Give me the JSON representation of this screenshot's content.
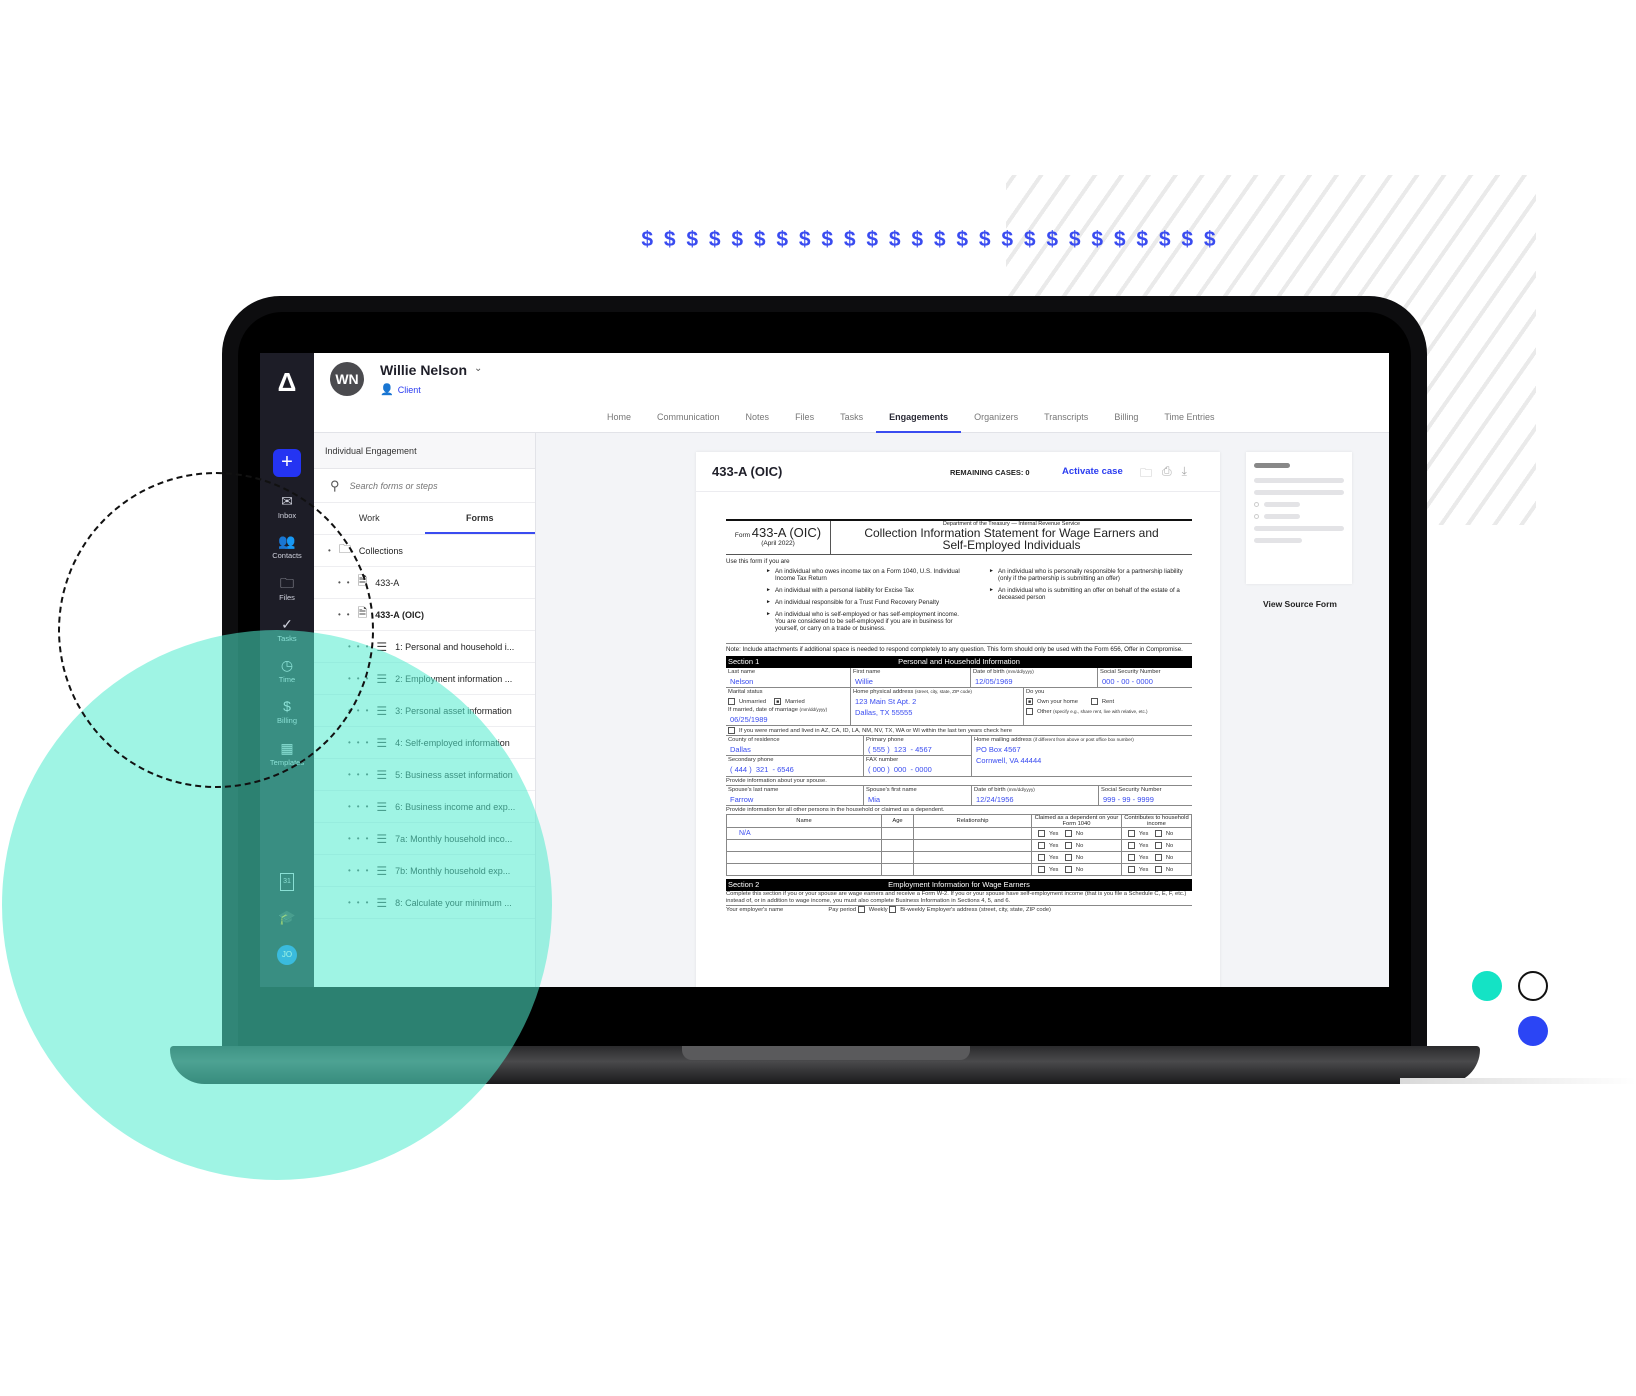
{
  "decor": {
    "dollar_glyph": "$",
    "dollar_count": 26,
    "colors": {
      "accent_blue": "#2a3cf0",
      "teal": "#14e3c5",
      "rail_bg": "#1d1d27"
    }
  },
  "rail": {
    "logo": "Δ",
    "new_button": "+",
    "items": [
      {
        "icon": "✉",
        "label": "Inbox"
      },
      {
        "icon": "👥",
        "label": "Contacts"
      },
      {
        "icon": "🗀",
        "label": "Files"
      },
      {
        "icon": "✓",
        "label": "Tasks"
      },
      {
        "icon": "◷",
        "label": "Time"
      },
      {
        "icon": "$",
        "label": "Billing"
      },
      {
        "icon": "▦",
        "label": "Templates"
      }
    ],
    "calendar_icon": "31",
    "learn_icon": "🎓",
    "user_initials": "JO"
  },
  "header": {
    "avatar_initials": "WN",
    "client_name": "Willie Nelson",
    "client_role": "Client",
    "tabs": [
      {
        "label": "Home",
        "active": false
      },
      {
        "label": "Communication",
        "active": false
      },
      {
        "label": "Notes",
        "active": false
      },
      {
        "label": "Files",
        "active": false
      },
      {
        "label": "Tasks",
        "active": false
      },
      {
        "label": "Engagements",
        "active": true
      },
      {
        "label": "Organizers",
        "active": false
      },
      {
        "label": "Transcripts",
        "active": false
      },
      {
        "label": "Billing",
        "active": false
      },
      {
        "label": "Time Entries",
        "active": false
      }
    ]
  },
  "sidebar": {
    "engagement_title": "Individual Engagement",
    "search_placeholder": "Search forms or steps",
    "toggle": {
      "work": "Work",
      "forms": "Forms",
      "active": "Forms"
    },
    "tree": [
      {
        "level": 1,
        "icon": "folder",
        "label": "Collections",
        "bold": false
      },
      {
        "level": 2,
        "icon": "doc",
        "label": "433-A",
        "bold": false
      },
      {
        "level": 2,
        "icon": "doc",
        "label": "433-A (OIC)",
        "bold": true
      },
      {
        "level": 3,
        "icon": "page",
        "label": "1: Personal and household i...",
        "bold": false
      },
      {
        "level": 3,
        "icon": "page",
        "label": "2: Employment information ...",
        "bold": false
      },
      {
        "level": 3,
        "icon": "page",
        "label": "3: Personal asset information",
        "bold": false
      },
      {
        "level": 3,
        "icon": "page",
        "label": "4: Self-employed information",
        "bold": false
      },
      {
        "level": 3,
        "icon": "page",
        "label": "5: Business asset information",
        "bold": false
      },
      {
        "level": 3,
        "icon": "page",
        "label": "6: Business income and exp...",
        "bold": false
      },
      {
        "level": 3,
        "icon": "page",
        "label": "7a: Monthly household inco...",
        "bold": false
      },
      {
        "level": 3,
        "icon": "page",
        "label": "7b: Monthly household exp...",
        "bold": false
      },
      {
        "level": 3,
        "icon": "page",
        "label": "8: Calculate your minimum ...",
        "bold": false
      }
    ]
  },
  "document": {
    "title": "433-A (OIC)",
    "remaining_cases": "REMAINING CASES: 0",
    "activate_label": "Activate case",
    "form": {
      "form_label": "Form",
      "form_number": "433-A (OIC)",
      "revision": "(April 2022)",
      "department": "Department of the Treasury — Internal Revenue Service",
      "title_line1": "Collection Information Statement for Wage Earners and",
      "title_line2": "Self-Employed Individuals",
      "use_if": "Use this form if you are",
      "bullets_left": [
        "An individual who owes income tax on a Form 1040, U.S. Individual Income Tax Return",
        "An individual with a personal liability for Excise Tax",
        "An individual responsible for a Trust Fund Recovery Penalty",
        "An individual who is self-employed or has self-employment income. You are considered to be self-employed if you are in business for yourself, or carry on a trade or business."
      ],
      "bullets_right": [
        "An individual who is personally responsible for a partnership liability (only if the partnership is submitting an offer)",
        "An individual who is submitting an offer on behalf of the estate of a deceased person"
      ],
      "note": "Note: Include attachments if additional space is needed to respond completely to any question. This form should only be used with the Form 656, Offer in Compromise.",
      "section1": {
        "number": "Section 1",
        "title": "Personal and Household Information"
      },
      "labels": {
        "last_name": "Last name",
        "first_name": "First name",
        "dob": "Date of birth",
        "dob_fmt": "(mm/dd/yyyy)",
        "ssn": "Social Security Number",
        "marital": "Marital status",
        "unmarried": "Unmarried",
        "married": "Married",
        "marriage_date": "If married, date of marriage",
        "home_address": "Home physical address",
        "home_address_fmt": "(street, city, state, ZIP code)",
        "do_you": "Do you",
        "own_home": "Own your home",
        "rent": "Rent",
        "other": "Other",
        "other_fmt": "(specify e.g., share rent, live with relative, etc.)",
        "community_prop": "If you were married and lived in AZ, CA, ID, LA, NM, NV, TX, WA or WI within the last ten years check here",
        "county": "County of residence",
        "primary_phone": "Primary phone",
        "mailing": "Home mailing address",
        "mailing_fmt": "(if different from above or post office box number)",
        "secondary_phone": "Secondary phone",
        "fax": "FAX number",
        "spouse_info": "Provide information about your spouse.",
        "spouse_last": "Spouse's last name",
        "spouse_first": "Spouse's first name",
        "others_info": "Provide information for all other persons in the household or claimed as a dependent.",
        "col_name": "Name",
        "col_age": "Age",
        "col_relationship": "Relationship",
        "col_dependent": "Claimed as a dependent on your Form 1040",
        "col_contributes": "Contributes to household income",
        "yes": "Yes",
        "no": "No"
      },
      "values": {
        "last_name": "Nelson",
        "first_name": "Willie",
        "dob": "12/05/1969",
        "ssn": [
          "000",
          "00",
          "0000"
        ],
        "marital_status": "Married",
        "marriage_date": "06/25/1989",
        "address_line1": "123 Main St Apt. 2",
        "address_line2": "Dallas, TX 55555",
        "housing": "Own your home",
        "county": "Dallas",
        "primary_phone": [
          "555",
          "123",
          "4567"
        ],
        "secondary_phone": [
          "444",
          "321",
          "6546"
        ],
        "fax": [
          "000",
          "000",
          "0000"
        ],
        "mailing_line1": "PO Box 4567",
        "mailing_line2": "Cornwell, VA 44444",
        "spouse_last": "Farrow",
        "spouse_first": "Mia",
        "spouse_dob": "12/24/1956",
        "spouse_ssn": [
          "999",
          "99",
          "9999"
        ],
        "household_member": "N/A"
      },
      "section2": {
        "number": "Section 2",
        "title": "Employment Information for Wage Earners"
      },
      "section2_note": "Complete this section if you or your spouse are wage earners and receive a Form W-2. If you or your spouse have self-employment income (that is you file a Schedule C, E, F, etc.) instead of, or in addition to wage income, you must also complete Business Information in Sections 4, 5, and 6.",
      "section2_labels": {
        "employer": "Your employer's name",
        "pay_period": "Pay period",
        "weekly": "Weekly",
        "biweekly": "Bi-weekly",
        "employer_address": "Employer's address (street, city, state, ZIP code)"
      }
    }
  },
  "source_panel": {
    "link_label": "View Source Form"
  }
}
